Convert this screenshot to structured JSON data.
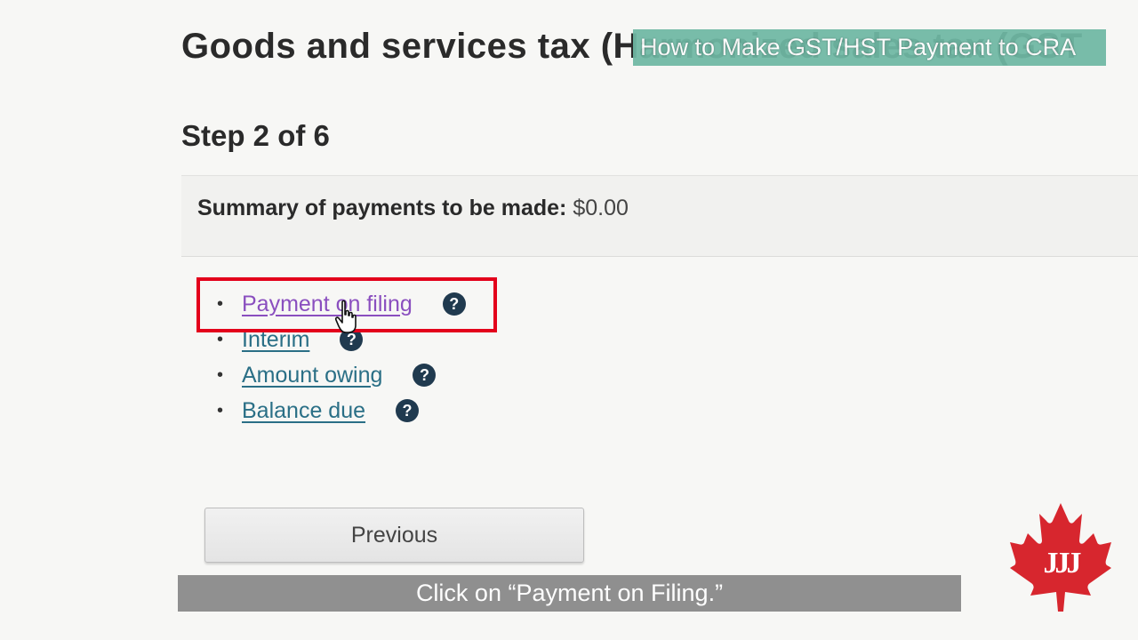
{
  "page": {
    "title": "Goods and services tax (Harmonized sales tax (GST",
    "step": "Step 2 of 6"
  },
  "video": {
    "banner": "How to Make GST/HST Payment to CRA",
    "caption": "Click on “Payment on Filing.”",
    "logo_letters": "JJJ"
  },
  "summary": {
    "label": "Summary of payments to be made:",
    "amount": "$0.00"
  },
  "payment_options": [
    {
      "label": "Payment on filing",
      "help_icon": "question-circle-icon",
      "visited": true
    },
    {
      "label": "Interim",
      "help_icon": "question-circle-icon",
      "visited": false
    },
    {
      "label": "Amount owing",
      "help_icon": "question-circle-icon",
      "visited": false
    },
    {
      "label": "Balance due",
      "help_icon": "question-circle-icon",
      "visited": false
    }
  ],
  "buttons": {
    "previous": "Previous"
  },
  "colors": {
    "link": "#2a6f86",
    "visited_link": "#8a4fbf",
    "highlight": "#e3001b",
    "banner": "#6fb8a4",
    "caption_bg": "#8a8a8a",
    "help_icon": "#203a4f"
  }
}
